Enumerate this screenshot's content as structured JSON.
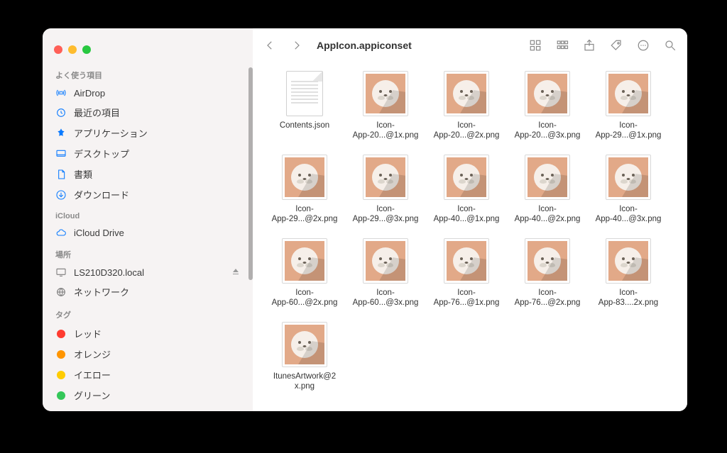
{
  "window": {
    "title": "AppIcon.appiconset"
  },
  "sidebar": {
    "sections": [
      {
        "label": "よく使う項目",
        "items": [
          {
            "icon": "airdrop",
            "label": "AirDrop"
          },
          {
            "icon": "clock",
            "label": "最近の項目"
          },
          {
            "icon": "apps",
            "label": "アプリケーション"
          },
          {
            "icon": "desktop",
            "label": "デスクトップ"
          },
          {
            "icon": "doc",
            "label": "書類"
          },
          {
            "icon": "download",
            "label": "ダウンロード"
          }
        ]
      },
      {
        "label": "iCloud",
        "items": [
          {
            "icon": "cloud",
            "label": "iCloud Drive"
          }
        ]
      },
      {
        "label": "場所",
        "items": [
          {
            "icon": "display",
            "label": "LS210D320.local",
            "ejectable": true
          },
          {
            "icon": "globe",
            "label": "ネットワーク"
          }
        ]
      },
      {
        "label": "タグ",
        "items": [
          {
            "icon": "tag",
            "color": "#ff3b30",
            "label": "レッド"
          },
          {
            "icon": "tag",
            "color": "#ff9500",
            "label": "オレンジ"
          },
          {
            "icon": "tag",
            "color": "#ffcc00",
            "label": "イエロー"
          },
          {
            "icon": "tag",
            "color": "#34c759",
            "label": "グリーン"
          }
        ]
      }
    ]
  },
  "files": [
    {
      "name_line1": "Contents.json",
      "name_line2": "",
      "type": "json"
    },
    {
      "name_line1": "Icon-",
      "name_line2": "App-20...@1x.png",
      "type": "seal"
    },
    {
      "name_line1": "Icon-",
      "name_line2": "App-20...@2x.png",
      "type": "seal"
    },
    {
      "name_line1": "Icon-",
      "name_line2": "App-20...@3x.png",
      "type": "seal"
    },
    {
      "name_line1": "Icon-",
      "name_line2": "App-29...@1x.png",
      "type": "seal"
    },
    {
      "name_line1": "Icon-",
      "name_line2": "App-29...@2x.png",
      "type": "seal"
    },
    {
      "name_line1": "Icon-",
      "name_line2": "App-29...@3x.png",
      "type": "seal"
    },
    {
      "name_line1": "Icon-",
      "name_line2": "App-40...@1x.png",
      "type": "seal"
    },
    {
      "name_line1": "Icon-",
      "name_line2": "App-40...@2x.png",
      "type": "seal"
    },
    {
      "name_line1": "Icon-",
      "name_line2": "App-40...@3x.png",
      "type": "seal"
    },
    {
      "name_line1": "Icon-",
      "name_line2": "App-60...@2x.png",
      "type": "seal"
    },
    {
      "name_line1": "Icon-",
      "name_line2": "App-60...@3x.png",
      "type": "seal"
    },
    {
      "name_line1": "Icon-",
      "name_line2": "App-76...@1x.png",
      "type": "seal"
    },
    {
      "name_line1": "Icon-",
      "name_line2": "App-76...@2x.png",
      "type": "seal"
    },
    {
      "name_line1": "Icon-",
      "name_line2": "App-83....2x.png",
      "type": "seal"
    },
    {
      "name_line1": "ItunesArtwork@2",
      "name_line2": "x.png",
      "type": "seal"
    }
  ]
}
